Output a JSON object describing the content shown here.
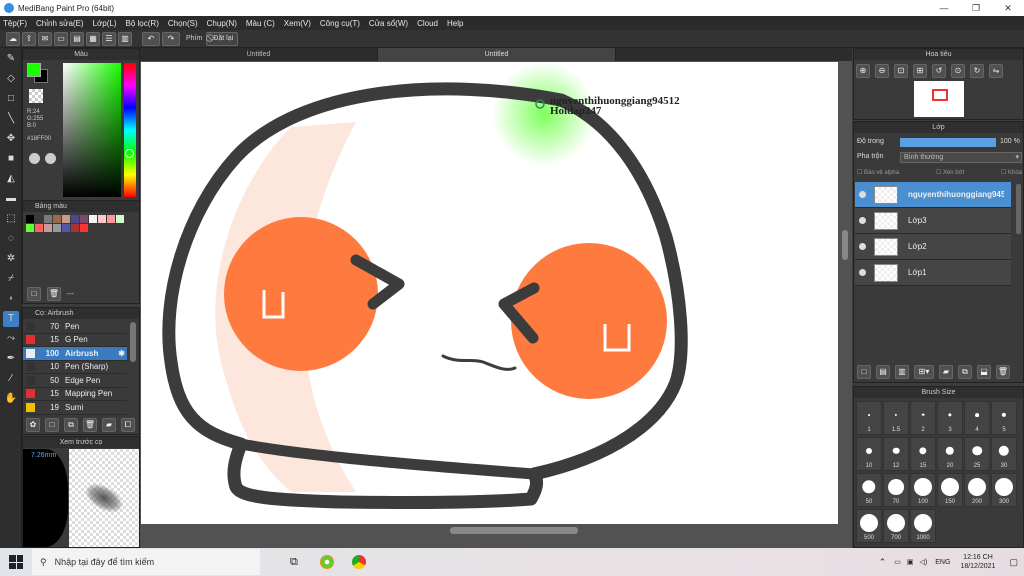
{
  "window": {
    "title": "MediBang Paint Pro (64bit)",
    "controls": [
      "—",
      "❐",
      "✕"
    ]
  },
  "menu": [
    "Tệp(F)",
    "Chỉnh sửa(E)",
    "Lớp(L)",
    "Bộ lọc(R)",
    "Chọn(S)",
    "Chụp(N)",
    "Màu (C)",
    "Xem(V)",
    "Công cụ(T)",
    "Cửa sổ(W)",
    "Cloud",
    "Help"
  ],
  "toolbar": {
    "keys_label": "Phím",
    "reset_label": "Đặt lại"
  },
  "tabs": [
    "Untitled",
    "Untitled"
  ],
  "color_panel": {
    "title": "Màu",
    "r": "R:24",
    "g": "G:255",
    "b": "B:0",
    "hex": "#18FF00",
    "fg": "#18ff00",
    "bg": "#000000"
  },
  "palette_panel": {
    "title": "Bảng màu",
    "dash": "---",
    "swatches": [
      "#000000",
      "#3a3a3a",
      "#7a7a7a",
      "#9a6a4a",
      "#c89a8a",
      "#4a4a8a",
      "#7a4a6a",
      "#f4f4f4",
      "#ffc8c8",
      "#ff9999",
      "#ccffcc",
      "#66ff33",
      "#ff6060",
      "#cc9999",
      "#999999",
      "#5555aa",
      "#aa3333",
      "#ff3333"
    ]
  },
  "brush_panel": {
    "title": "Cọ: Airbrush",
    "items": [
      {
        "size": "70",
        "name": "Pen",
        "color": "#333333"
      },
      {
        "size": "15",
        "name": "G Pen",
        "color": "#e03030"
      },
      {
        "size": "100",
        "name": "Airbrush",
        "color": "#eeeeee"
      },
      {
        "size": "10",
        "name": "Pen (Sharp)",
        "color": "#333333"
      },
      {
        "size": "50",
        "name": "Edge Pen",
        "color": "#333333"
      },
      {
        "size": "15",
        "name": "Mapping Pen",
        "color": "#e03030"
      },
      {
        "size": "19",
        "name": "Sumi",
        "color": "#f0c000"
      }
    ]
  },
  "preview_panel": {
    "title": "Xem trước cọ",
    "size": "7.26mm"
  },
  "navigator_panel": {
    "title": "Hoa tiêu"
  },
  "layer_panel": {
    "title": "Lớp",
    "opacity_label": "Độ trong",
    "opacity_value": "100 %",
    "opacity_percent": 100,
    "blend_label": "Pha trộn",
    "blend_value": "Bình thường",
    "protect_alpha": "Bảo vệ alpha",
    "clip": "Xén bớt",
    "lock": "Khóa",
    "layers": [
      "nguyenthihuonggiang94512",
      "Lớp3",
      "Lớp2",
      "Lớp1"
    ]
  },
  "brush_size_panel": {
    "title": "Brush Size",
    "sizes": [
      "1",
      "1.5",
      "2",
      "3",
      "4",
      "5",
      "10",
      "12",
      "15",
      "20",
      "25",
      "30",
      "50",
      "70",
      "100",
      "150",
      "200",
      "300",
      "500",
      "700",
      "1000"
    ]
  },
  "canvas_text": {
    "line1": "nguyenthihuonggiang94512",
    "line2": "Hoidap247"
  },
  "taskbar": {
    "search_placeholder": "Nhập tại đây để tìm kiếm",
    "lang": "ENG",
    "time": "12:16 CH",
    "date": "18/12/2021"
  }
}
